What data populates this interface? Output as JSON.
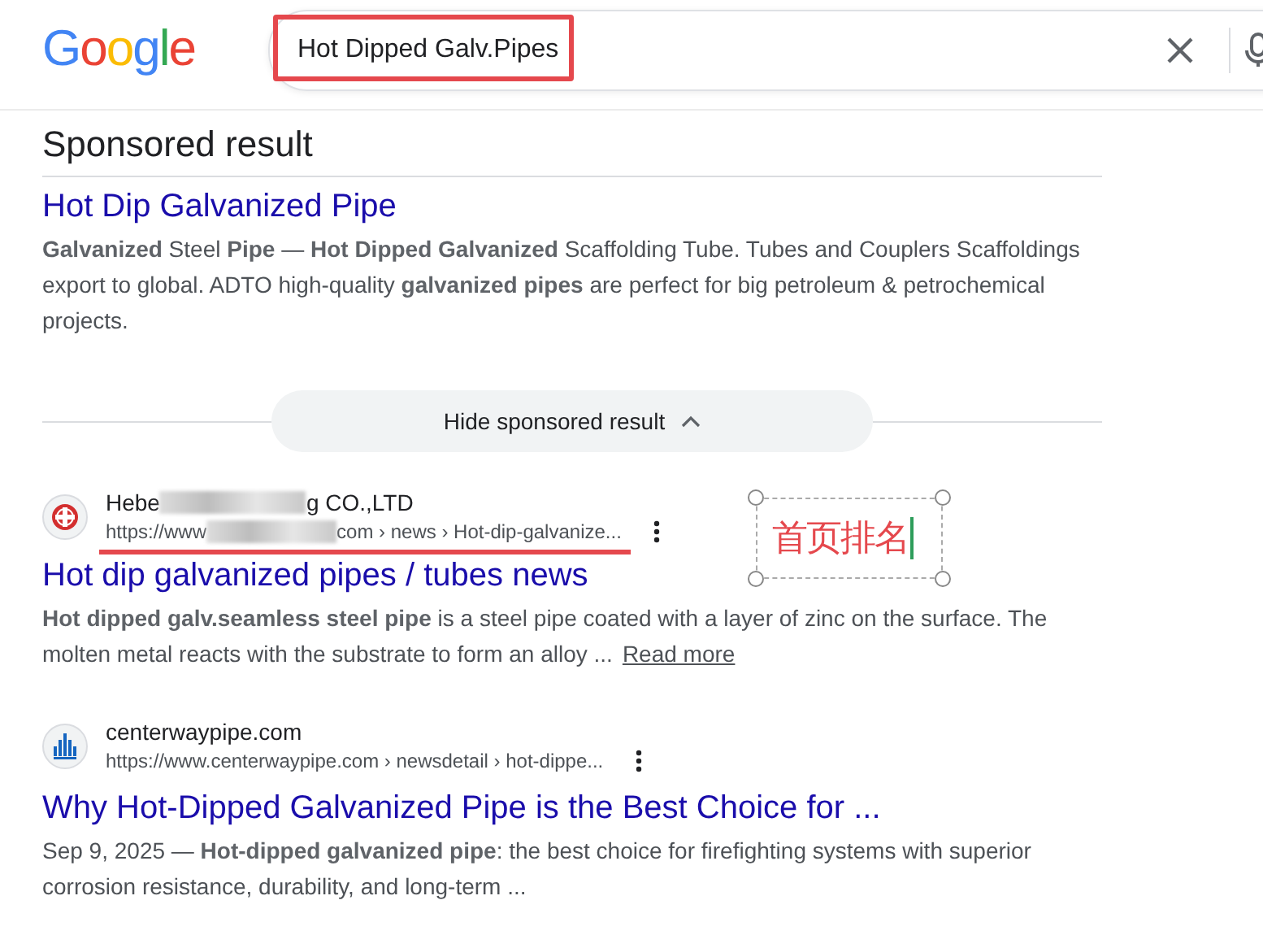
{
  "header": {
    "logo": "Google",
    "query": "Hot Dipped Galv.Pipes",
    "query_marked": true
  },
  "sponsored": {
    "heading": "Sponsored result",
    "title": "Hot Dip Galvanized Pipe",
    "snippet": "**Galvanized** Steel **Pipe** — **Hot Dipped Galvanized** Scaffolding Tube. Tubes and Couplers Scaffoldings export to global. ADTO high-quality **galvanized pipes** are perfect for big petroleum & petrochemical projects.",
    "hide_button": "Hide sponsored result"
  },
  "results": [
    {
      "kind": "red-emblem",
      "site_parts": [
        "Hebe",
        "g CO.,LTD"
      ],
      "url_parts": [
        "https://www",
        "com › news › Hot-dip-galvanize..."
      ],
      "underlined": true,
      "title": "Hot dip galvanized pipes / tubes news",
      "snippet": "**Hot dipped galv.seamless steel pipe** is a steel pipe coated with a layer of zinc on the surface. The molten metal reacts with the substrate to form an alloy ...",
      "more": "Read more"
    },
    {
      "kind": "blue-towers",
      "site_parts": [
        "centerwaypipe.com"
      ],
      "url_parts": [
        "https://www.centerwaypipe.com › newsdetail › hot-dippe..."
      ],
      "underlined": false,
      "title": "Why Hot-Dipped Galvanized Pipe is the Best Choice for ...",
      "snippet": "Sep 9, 2025 — **Hot-dipped galvanized pipe**: the best choice for firefighting systems with superior corrosion resistance, durability, and long-term ..."
    }
  ],
  "annotation": {
    "label": "首页排名"
  }
}
